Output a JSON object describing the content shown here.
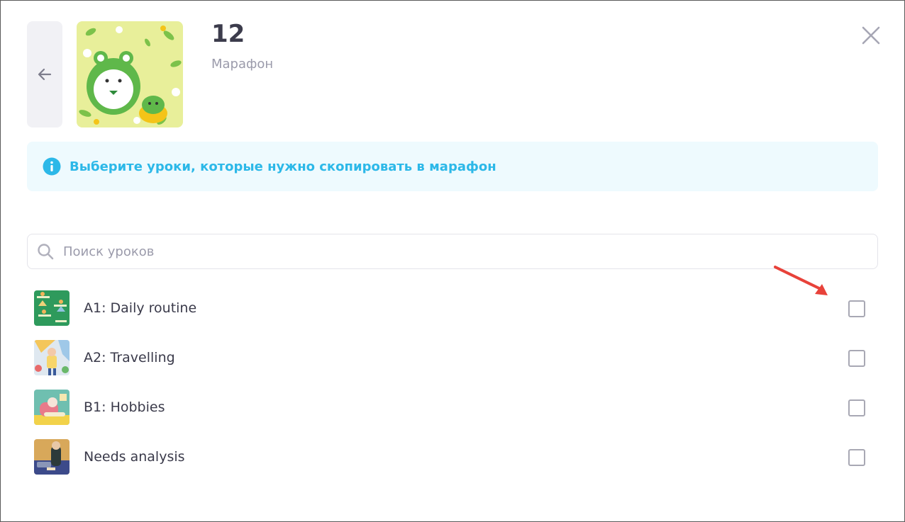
{
  "header": {
    "title": "12",
    "subtitle": "Марафон",
    "back_icon": "arrow-left-icon",
    "close_icon": "close-icon"
  },
  "info": {
    "icon": "info-icon",
    "text": "Выберите уроки, которые нужно скопировать в марафон",
    "color": "#2cb8e8"
  },
  "search": {
    "icon": "search-icon",
    "placeholder": "Поиск уроков",
    "value": ""
  },
  "lessons": [
    {
      "title": "A1: Daily routine",
      "checked": false
    },
    {
      "title": "A2: Travelling",
      "checked": false
    },
    {
      "title": "B1: Hobbies",
      "checked": false
    },
    {
      "title": "Needs analysis",
      "checked": false
    }
  ],
  "annotation": {
    "type": "red-arrow",
    "color": "#e8423a"
  }
}
